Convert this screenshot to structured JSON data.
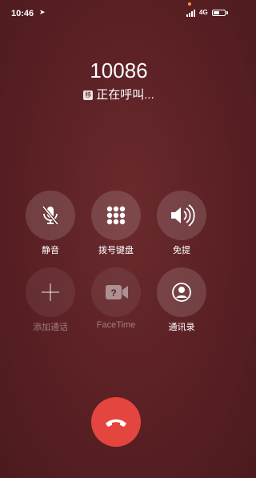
{
  "status_bar": {
    "time": "10:46",
    "network": "4G",
    "battery_level": 0.5
  },
  "call": {
    "number": "10086",
    "carrier_badge": "移",
    "status": "正在呼叫..."
  },
  "controls": {
    "mute": {
      "label": "静音",
      "icon": "mic-off-icon",
      "enabled": true
    },
    "keypad": {
      "label": "拨号键盘",
      "icon": "keypad-icon",
      "enabled": true
    },
    "speaker": {
      "label": "免提",
      "icon": "speaker-icon",
      "enabled": true
    },
    "add_call": {
      "label": "添加通话",
      "icon": "plus-icon",
      "enabled": false
    },
    "facetime": {
      "label": "FaceTime",
      "icon": "video-camera-icon",
      "enabled": false
    },
    "contacts": {
      "label": "通讯录",
      "icon": "contact-icon",
      "enabled": true
    }
  },
  "end_call": {
    "icon": "phone-hangup-icon",
    "color": "#e5453f"
  },
  "colors": {
    "background": "#5a2024",
    "accent_dot": "#f39a2b"
  }
}
